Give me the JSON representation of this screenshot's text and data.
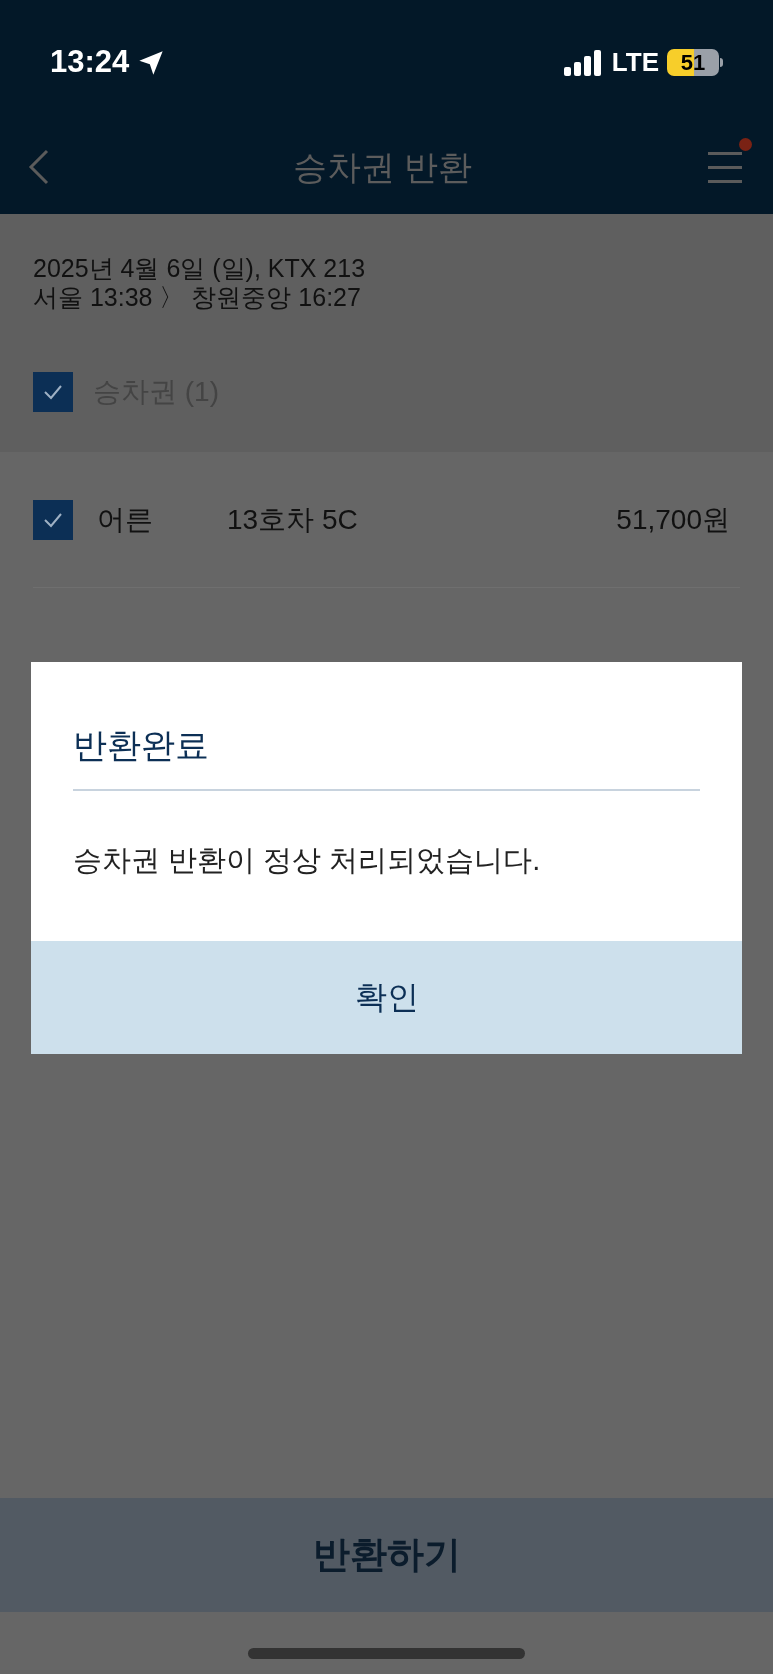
{
  "status_bar": {
    "time": "13:24",
    "network": "LTE",
    "battery": "51"
  },
  "header": {
    "title": "승차권 반환"
  },
  "journey": {
    "date_line": "2025년 4월 6일 (일), KTX 213",
    "route_line": "서울 13:38 〉 창원중앙 16:27"
  },
  "section": {
    "label": "승차권 (1)",
    "checked": true
  },
  "tickets": [
    {
      "passenger": "어른",
      "seat": "13호차 5C",
      "price": "51,700원",
      "checked": true
    }
  ],
  "dialog": {
    "title": "반환완료",
    "message": "승차권 반환이 정상 처리되었습니다.",
    "button": "확인"
  },
  "bottom_button": "반환하기"
}
